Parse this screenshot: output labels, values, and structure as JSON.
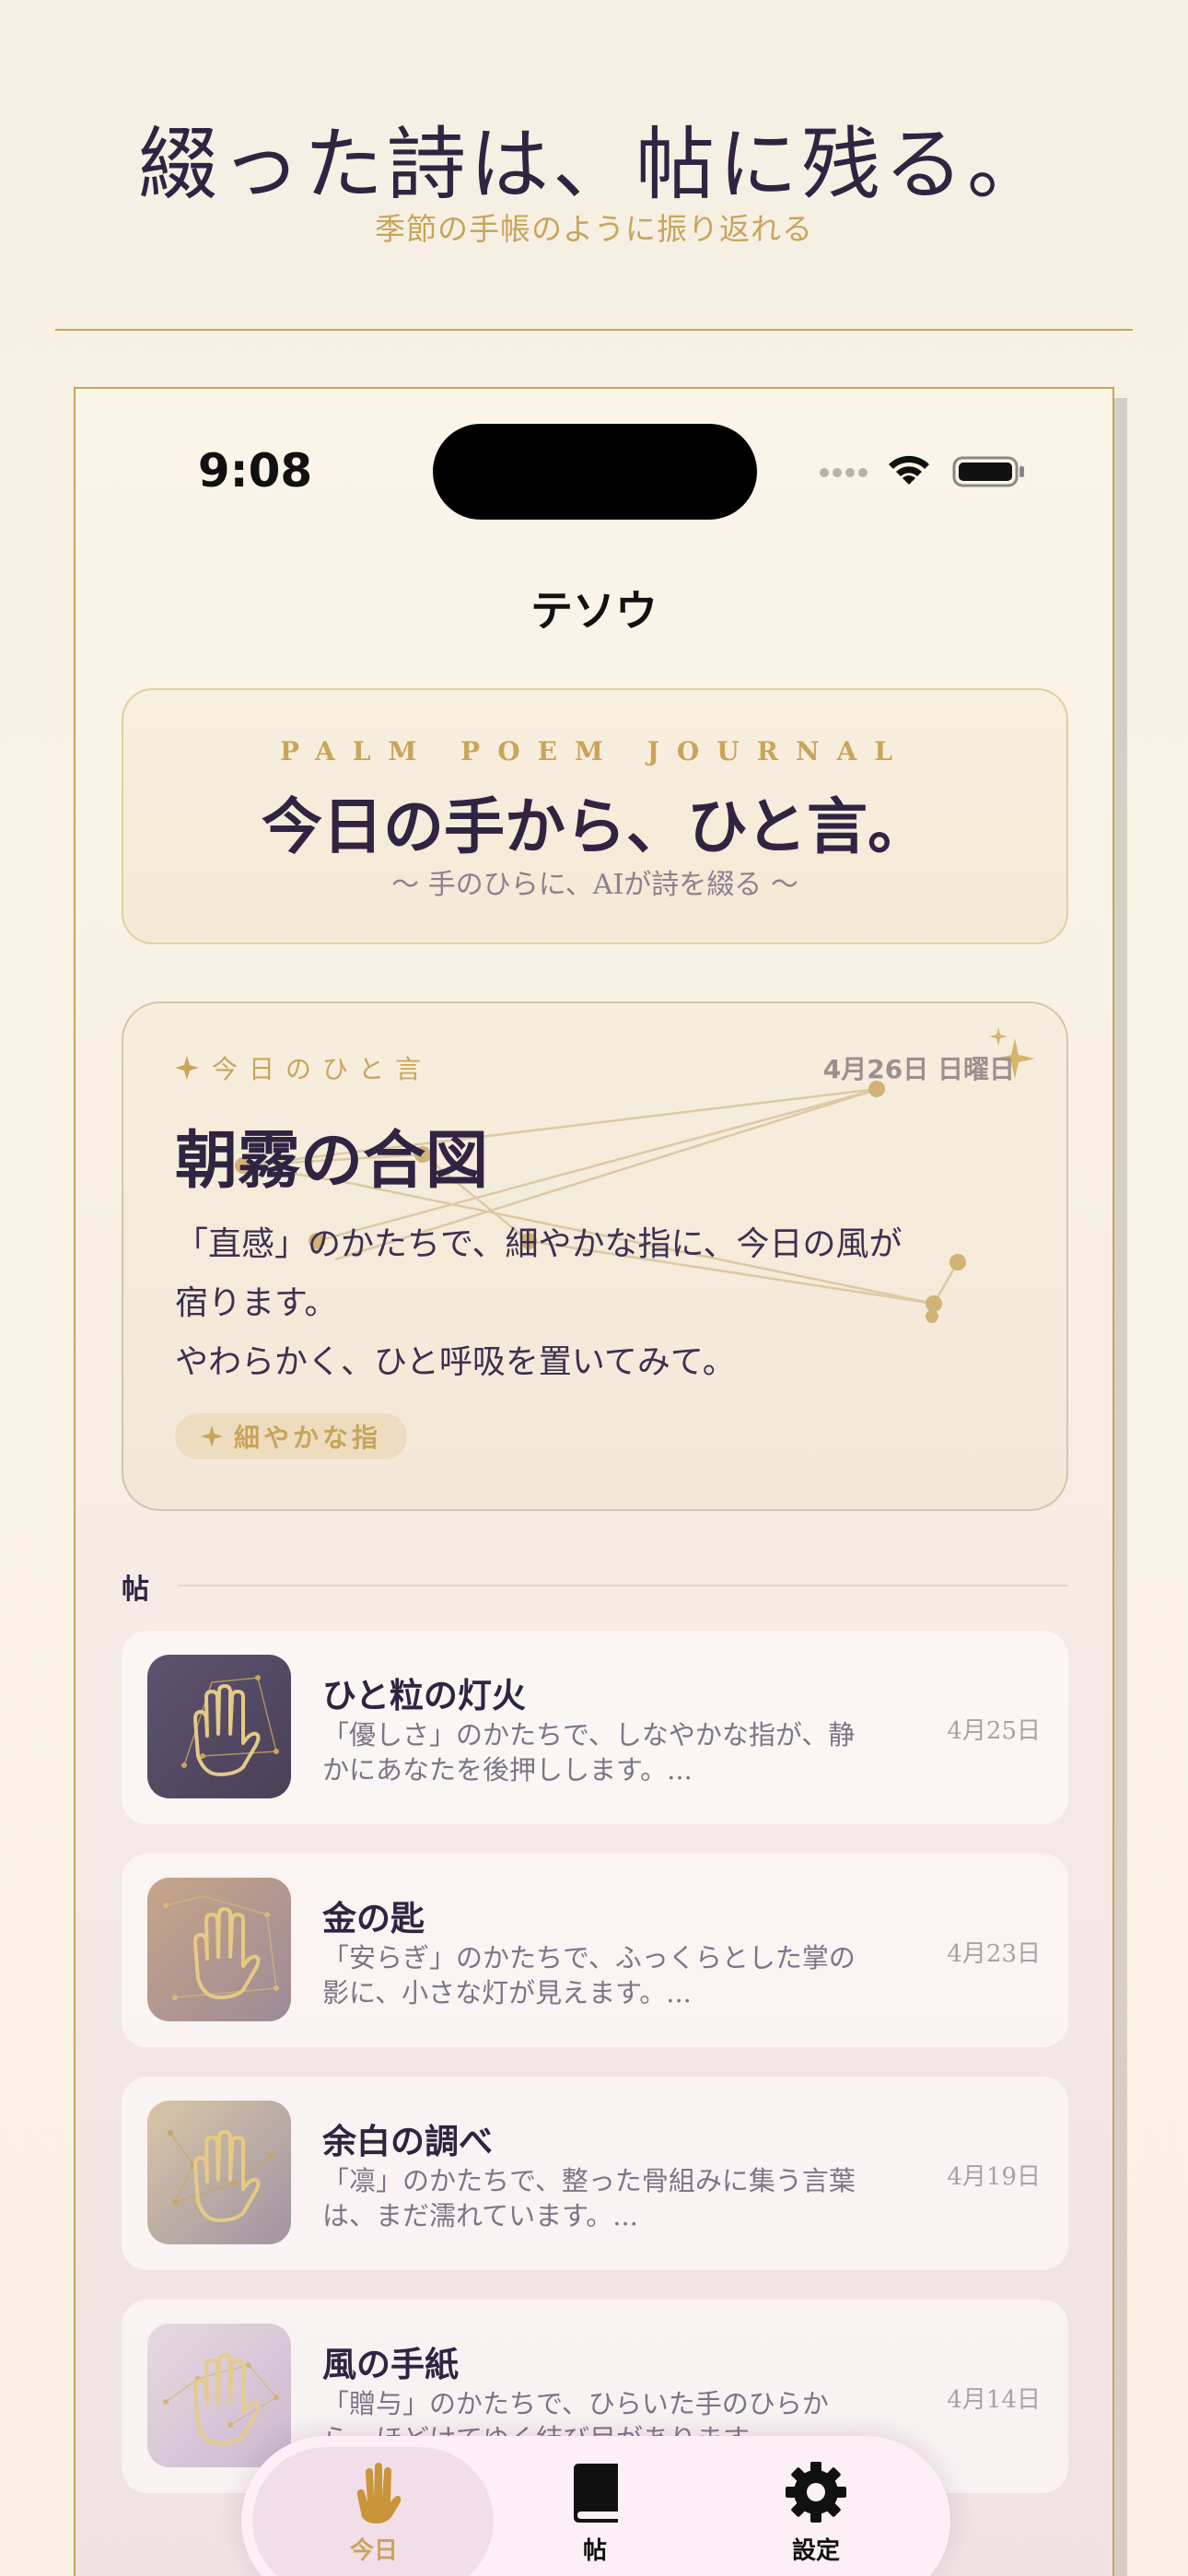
{
  "banner": {
    "title": "綴った詩は、帖に残る。",
    "subtitle": "季節の手帳のように振り返れる"
  },
  "status_bar": {
    "time": "9:08"
  },
  "nav": {
    "title": "テソウ"
  },
  "hero": {
    "eyebrow": "PALM POEM JOURNAL",
    "title": "今日の手から、ひと言。",
    "subtitle": "〜 手のひらに、AIが詩を綴る 〜"
  },
  "today": {
    "label": "今日のひと言",
    "date": "4月26日 日曜日",
    "title": "朝霧の合図",
    "body": [
      "「直感」のかたちで、細やかな指に、今日の風が",
      "宿ります。",
      "やわらかく、ひと呼吸を置いてみて。"
    ],
    "chip": "細やかな指"
  },
  "journal": {
    "section_label": "帖",
    "entries": [
      {
        "title": "ひと粒の灯火",
        "excerpt": "「優しさ」のかたちで、しなやかな指が、静かにあなたを後押しします。...",
        "date": "4月25日",
        "thumb_colors": [
          "#5e536f",
          "#4a4058"
        ]
      },
      {
        "title": "金の匙",
        "excerpt": "「安らぎ」のかたちで、ふっくらとした掌の影に、小さな灯が見えます。...",
        "date": "4月23日",
        "thumb_colors": [
          "#c7a588",
          "#9e8a98"
        ]
      },
      {
        "title": "余白の調べ",
        "excerpt": "「凛」のかたちで、整った骨組みに集う言葉は、まだ濡れています。...",
        "date": "4月19日",
        "thumb_colors": [
          "#d9c6a6",
          "#9f94a4"
        ]
      },
      {
        "title": "風の手紙",
        "excerpt": "「贈与」のかたちで、ひらいた手のひらから、ほどけてゆく結び目があります。...",
        "date": "4月14日",
        "thumb_colors": [
          "#e8d8e0",
          "#cbb9cf"
        ]
      }
    ]
  },
  "tabs": [
    {
      "label": "今日",
      "icon": "hand-icon",
      "active": true
    },
    {
      "label": "帖",
      "icon": "book-icon",
      "active": false
    },
    {
      "label": "設定",
      "icon": "gear-icon",
      "active": false
    }
  ],
  "colors": {
    "accent": "#c9a55a",
    "ink": "#2f2442",
    "muted": "#7d7488"
  }
}
